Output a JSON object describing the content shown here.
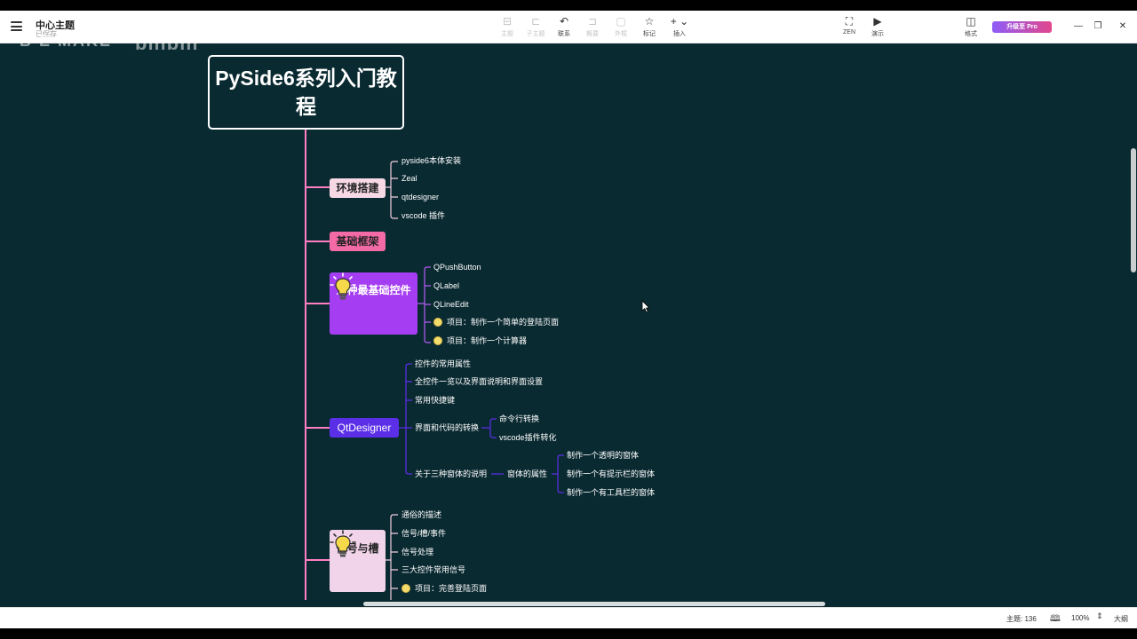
{
  "app": {
    "title": "中心主题",
    "subtitle": "已保存"
  },
  "toolbar": {
    "items": [
      {
        "label": "主题",
        "icon": "topic-icon",
        "glyph": "⊟",
        "disabled": true
      },
      {
        "label": "子主题",
        "icon": "subtopic-icon",
        "glyph": "⊏",
        "disabled": true
      },
      {
        "label": "联系",
        "icon": "relationship-icon",
        "glyph": "↶",
        "disabled": false
      },
      {
        "label": "概要",
        "icon": "summary-icon",
        "glyph": "⊐",
        "disabled": true
      },
      {
        "label": "外框",
        "icon": "boundary-icon",
        "glyph": "▢",
        "disabled": true
      },
      {
        "label": "标记",
        "icon": "marker-star-icon",
        "glyph": "☆",
        "disabled": false
      },
      {
        "label": "插入",
        "icon": "insert-plus-icon",
        "glyph": "+ ⌄",
        "disabled": false
      },
      {
        "label": "ZEN",
        "icon": "zen-icon",
        "glyph": "⛶",
        "disabled": false
      },
      {
        "label": "演示",
        "icon": "present-icon",
        "glyph": "▶",
        "disabled": false
      },
      {
        "label": "格式",
        "icon": "format-panel-icon",
        "glyph": "◫",
        "disabled": false
      }
    ],
    "upgrade_label": "升级至 Pro"
  },
  "watermark": {
    "text": "B E  MAKE",
    "text2": "bilibili"
  },
  "mindmap": {
    "root": "PySide6系列入门教程",
    "branches": [
      {
        "label": "环境搭建",
        "children": [
          "pyside6本体安装",
          "Zeal",
          "qtdesigner",
          "vscode 插件"
        ]
      },
      {
        "label": "基础框架",
        "children": []
      },
      {
        "label": "三种最基础控件",
        "children": [
          "QPushButton",
          "QLabel",
          "QLineEdit",
          "项目：制作一个简单的登陆页面",
          "项目：制作一个计算器"
        ]
      },
      {
        "label": "QtDesigner",
        "children": [
          "控件的常用属性",
          "全控件一览以及界面说明和界面设置",
          "常用快捷键",
          "界面和代码的转换",
          "关于三种窗体的说明"
        ],
        "sub": {
          "conversion": [
            "命令行转换",
            "vscode插件转化"
          ],
          "window_attr": "窗体的属性",
          "windows": [
            "制作一个透明的窗体",
            "制作一个有提示栏的窗体",
            "制作一个有工具栏的窗体"
          ]
        }
      },
      {
        "label": "信号与槽",
        "children": [
          "通俗的描述",
          "信号/槽/事件",
          "信号处理",
          "三大控件常用信号",
          "项目：完善登陆页面"
        ]
      }
    ]
  },
  "status": {
    "topics": "主题: 136",
    "zoom": "100%",
    "outline": "大纲"
  },
  "colors": {
    "canvas_bg": "#0a2a31",
    "root_line": "#ff7fc2",
    "env": "#f7d9e6",
    "basic": "#f26aa6",
    "controls": "#a53ef2",
    "qtdesigner": "#5b2ee8",
    "signals": "#f2d4ea"
  }
}
